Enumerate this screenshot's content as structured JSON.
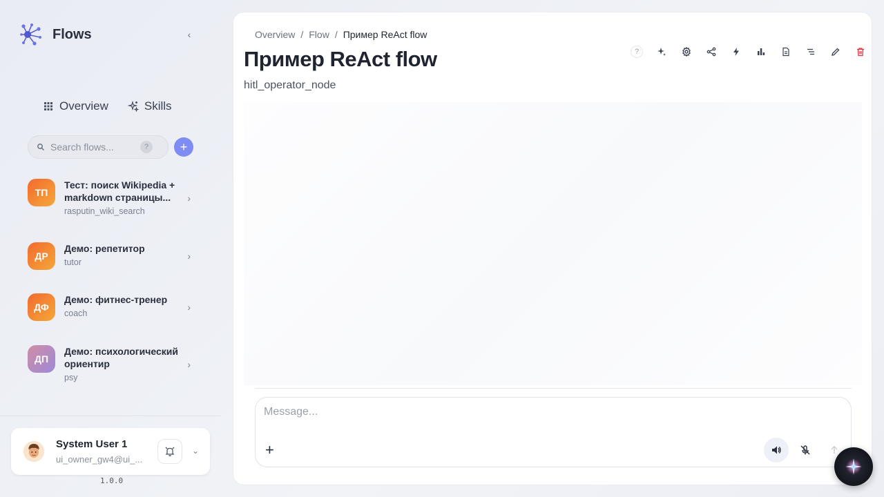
{
  "app": {
    "name": "Flows",
    "version": "1.0.0"
  },
  "nav": [
    {
      "label": "Overview",
      "icon": "grid-icon"
    },
    {
      "label": "Skills",
      "icon": "sparkles-icon"
    }
  ],
  "search": {
    "placeholder": "Search flows...",
    "help": "?"
  },
  "flows": [
    {
      "initials": "ТП",
      "title": "Тест: поиск Wikipedia + markdown страницы...",
      "slug": "rasputin_wiki_search",
      "color": "orange"
    },
    {
      "initials": "ДР",
      "title": "Демо: репетитор",
      "slug": "tutor",
      "color": "orange"
    },
    {
      "initials": "ДФ",
      "title": "Демо: фитнес-тренер",
      "slug": "coach",
      "color": "orange"
    },
    {
      "initials": "ДП",
      "title": "Демо: психологический ориентир",
      "slug": "psy",
      "color": "purple"
    }
  ],
  "user": {
    "name": "System User 1",
    "email": "ui_owner_gw4@ui_..."
  },
  "breadcrumb": {
    "items": [
      "Overview",
      "Flow"
    ],
    "current": "Пример ReAct flow"
  },
  "page": {
    "title": "Пример ReAct flow",
    "subtitle": "hitl_operator_node"
  },
  "toolbar": {
    "help": "?",
    "icons": [
      "magic-icon",
      "settings-icon",
      "share-icon",
      "bolt-icon",
      "chart-icon",
      "document-icon",
      "outline-icon",
      "edit-icon",
      "delete-icon"
    ]
  },
  "composer": {
    "placeholder": "Message..."
  },
  "colors": {
    "accent": "#7f8cf3",
    "danger": "#e0343f",
    "orange": "#f26a2e"
  }
}
